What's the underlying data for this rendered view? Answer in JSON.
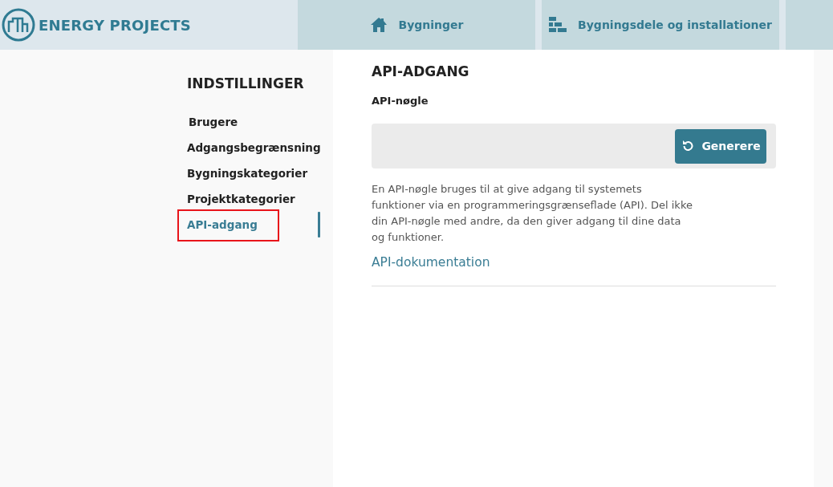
{
  "brand": {
    "name": "ENERGY PROJECTS"
  },
  "top_tabs": [
    {
      "label": "Bygninger",
      "kind": "house"
    },
    {
      "label": "Bygningsdele og installationer",
      "kind": "bricks"
    },
    {
      "kind": "blank"
    }
  ],
  "settings_nav": {
    "title": "INDSTILLINGER",
    "items": [
      {
        "label": "Brugere",
        "selected": false,
        "highlighted": false
      },
      {
        "label": "Adgangsbegrænsning",
        "selected": false,
        "highlighted": false
      },
      {
        "label": "Bygningskategorier",
        "selected": false,
        "highlighted": false
      },
      {
        "label": "Projektkategorier",
        "selected": false,
        "highlighted": false
      },
      {
        "label": "API-adgang",
        "selected": true,
        "highlighted": true
      }
    ]
  },
  "api_panel": {
    "title": "API-ADGANG",
    "key_label": "API-nøgle",
    "generate_button": "Generere",
    "description": "En API-nøgle bruges til at give adgang til systemets funktioner via en programmeringsgrænseflade (API). Del ikke din API-nøgle med andre, da den giver adgang til dine data og funktioner.",
    "doc_link": "API-dokumentation"
  }
}
